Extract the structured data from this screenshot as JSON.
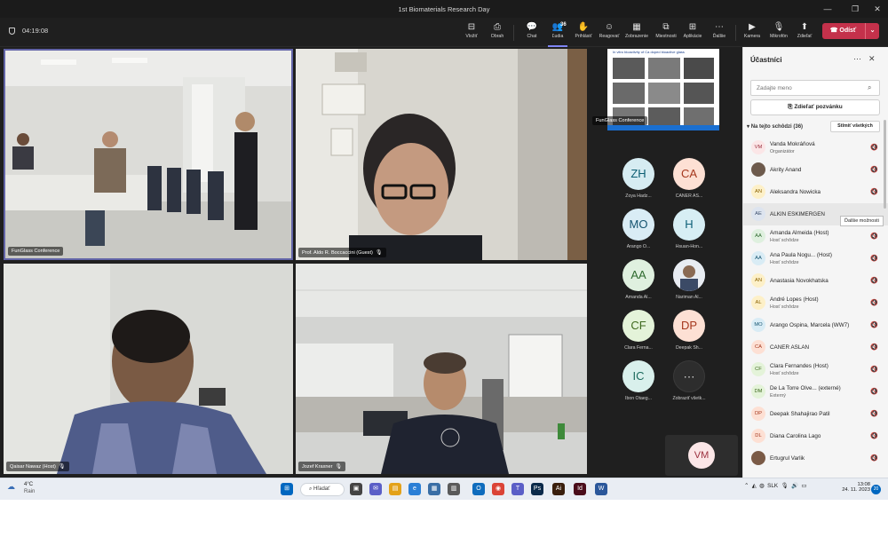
{
  "window": {
    "title": "1st Biomaterials Research Day",
    "minimize": "—",
    "maximize": "❐",
    "close": "✕"
  },
  "toolbar": {
    "timer": "04:19:08",
    "buttons": [
      {
        "label": "Vložiť",
        "icon": "⊟"
      },
      {
        "label": "Obrah",
        "icon": "⎙"
      },
      {
        "label": "Chat",
        "icon": "💬"
      },
      {
        "label": "Ľudia",
        "icon": "👥",
        "badge": "36"
      },
      {
        "label": "Prihlásiť",
        "icon": "✋"
      },
      {
        "label": "Reagovať",
        "icon": "☺"
      },
      {
        "label": "Zobrazenie",
        "icon": "▦"
      },
      {
        "label": "Miestnosti",
        "icon": "⧉"
      },
      {
        "label": "Aplikácie",
        "icon": "⊞"
      },
      {
        "label": "Ďalšie",
        "icon": "⋯"
      },
      {
        "label": "Kamera",
        "icon": "▶"
      },
      {
        "label": "Mikrofón",
        "icon": "🎙"
      },
      {
        "label": "Zdieľať",
        "icon": "⬆"
      }
    ],
    "leave_label": "Odísť",
    "leave_caret": "⌄"
  },
  "videos": {
    "room": "FunGlass Conference",
    "speaker1": "Prof. Aldo R. Boccaccini (Guest)",
    "speaker2": "Qaisar Nawaz (Host)",
    "speaker3": "Jozef Kraxner",
    "slide": "FunGlass Conference",
    "slide_heading": "In vitro bioactivity of Ca doped bioactive glass"
  },
  "gallery": [
    {
      "initials": "ZH",
      "name": "Zoya Hadz...",
      "bg": "#d6ecf2",
      "fg": "#0b5d72"
    },
    {
      "initials": "CA",
      "name": "CANER AS...",
      "bg": "#fde0d4",
      "fg": "#a5371d"
    },
    {
      "initials": "MO",
      "name": "Arango O...",
      "bg": "#d9ecf5",
      "fg": "#14536f"
    },
    {
      "initials": "H",
      "name": "Hsuan-Hon...",
      "bg": "#d7eef4",
      "fg": "#0e6078"
    },
    {
      "initials": "AA",
      "name": "Amanda Al...",
      "bg": "#dff0df",
      "fg": "#2e6a2e"
    },
    {
      "initials": "",
      "name": "Nariman Al...",
      "bg": "#cfd8e6",
      "fg": "#333333"
    },
    {
      "initials": "CF",
      "name": "Clara Ferna...",
      "bg": "#e4f3d9",
      "fg": "#3f6a1f"
    },
    {
      "initials": "DP",
      "name": "Deepak Sh...",
      "bg": "#fde0d4",
      "fg": "#a5371d"
    },
    {
      "initials": "IC",
      "name": "Ibon Otaeg...",
      "bg": "#d9f0ec",
      "fg": "#1c6a5d"
    },
    {
      "initials": "⋯",
      "name": "Zobraziť všetk...",
      "bg": "#2d2d2d",
      "fg": "#cfcfcf"
    }
  ],
  "self_view": {
    "initials": "VM"
  },
  "panel": {
    "title": "Účastníci",
    "search_placeholder": "Zadajte meno",
    "share_label": "Zdieľať pozvánku",
    "section": "Na tejto schôdzi (36)",
    "mute_all": "Stlmiť všetkých",
    "tooltip": "Ďalšie možnosti",
    "participants": [
      {
        "initials": "VM",
        "name": "Vanda Mokráňová",
        "role": "Organizátor",
        "bg": "#fbe6e7",
        "fg": "#9b2f3d"
      },
      {
        "initials": "",
        "name": "Akrity Anand",
        "role": "",
        "bg": "#6d5a4c",
        "fg": "#ffffff"
      },
      {
        "initials": "AN",
        "name": "Aleksandra Nowicka",
        "role": "",
        "bg": "#fdf0c8",
        "fg": "#8a6100"
      },
      {
        "initials": "AE",
        "name": "ALKIN ESKIMERGEN",
        "role": "",
        "bg": "#dde4ef",
        "fg": "#3d4f6e"
      },
      {
        "initials": "AA",
        "name": "Amanda Almeida (Host)",
        "role": "Hosť schôdze",
        "bg": "#dff0df",
        "fg": "#2e6a2e"
      },
      {
        "initials": "AA",
        "name": "Ana Paula Nogu... (Host)",
        "role": "Hosť schôdze",
        "bg": "#d9ecf5",
        "fg": "#14536f"
      },
      {
        "initials": "AN",
        "name": "Anastasia Novokhatska",
        "role": "",
        "bg": "#fdf0c8",
        "fg": "#8a6100"
      },
      {
        "initials": "AL",
        "name": "André Lopes (Host)",
        "role": "Hosť schôdze",
        "bg": "#fdf0c8",
        "fg": "#8a6100"
      },
      {
        "initials": "MO",
        "name": "Arango Ospina, Marcela (WW7)",
        "role": "",
        "bg": "#d9ecf5",
        "fg": "#14536f"
      },
      {
        "initials": "CA",
        "name": "CANER ASLAN",
        "role": "",
        "bg": "#fde0d4",
        "fg": "#a5371d"
      },
      {
        "initials": "CF",
        "name": "Clara Fernandes (Host)",
        "role": "Hosť schôdze",
        "bg": "#e4f3d9",
        "fg": "#3f6a1f"
      },
      {
        "initials": "DM",
        "name": "De La Torre Olve... (externé)",
        "role": "Externý",
        "bg": "#e4f3d9",
        "fg": "#3f6a1f"
      },
      {
        "initials": "DP",
        "name": "Deepak Shahajirao Patil",
        "role": "",
        "bg": "#fde0d4",
        "fg": "#a5371d"
      },
      {
        "initials": "DL",
        "name": "Diana Carolina Lago",
        "role": "",
        "bg": "#fde0d4",
        "fg": "#a5371d"
      },
      {
        "initials": "",
        "name": "Ertugrul Varlik",
        "role": "",
        "bg": "#7a5a46",
        "fg": "#ffffff"
      }
    ]
  },
  "taskbar": {
    "temp": "4°C",
    "condition": "Rain",
    "search_label": "Hľadať",
    "lang": "SLK",
    "time": "13:08",
    "date": "24. 11. 2023",
    "notifications": "20"
  }
}
